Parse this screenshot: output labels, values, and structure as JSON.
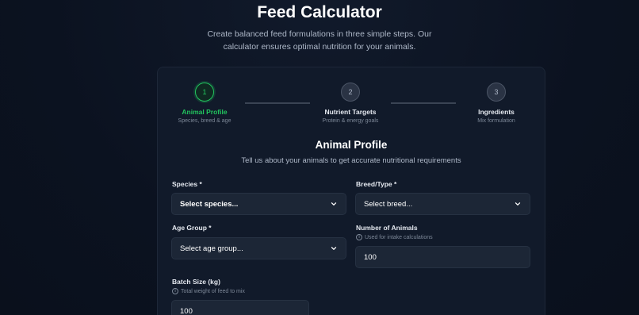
{
  "header": {
    "title": "Feed Calculator",
    "subtitle": "Create balanced feed formulations in three simple steps. Our calculator ensures optimal nutrition for your animals."
  },
  "stepper": {
    "steps": [
      {
        "number": "1",
        "label": "Animal Profile",
        "sub": "Species, breed & age",
        "active": true
      },
      {
        "number": "2",
        "label": "Nutrient Targets",
        "sub": "Protein & energy goals",
        "active": false
      },
      {
        "number": "3",
        "label": "Ingredients",
        "sub": "Mix formulation",
        "active": false
      }
    ]
  },
  "section": {
    "title": "Animal Profile",
    "subtitle": "Tell us about your animals to get accurate nutritional requirements"
  },
  "form": {
    "species": {
      "label": "Species *",
      "value": "Select species..."
    },
    "breed": {
      "label": "Breed/Type *",
      "value": "Select breed..."
    },
    "age_group": {
      "label": "Age Group *",
      "value": "Select age group..."
    },
    "num_animals": {
      "label": "Number of Animals",
      "hint": "Used for intake calculations",
      "value": "100"
    },
    "batch_size": {
      "label": "Batch Size (kg)",
      "hint": "Total weight of feed to mix",
      "value": "100"
    }
  },
  "colors": {
    "accent": "#22c55e",
    "background": "#0b1220",
    "card": "#111a2a",
    "control": "#1c2636"
  }
}
